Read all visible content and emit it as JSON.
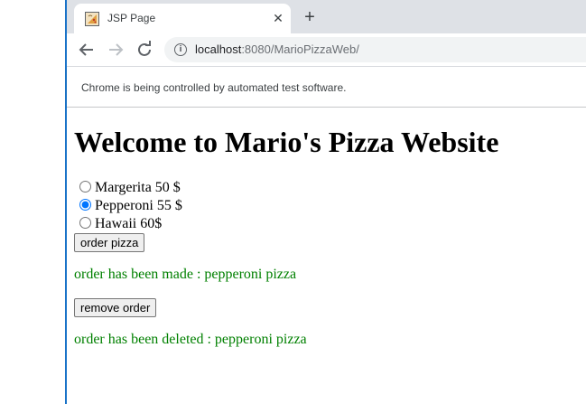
{
  "browser": {
    "tab_title": "JSP Page",
    "url_host": "localhost",
    "url_path": ":8080/MarioPizzaWeb/",
    "infobar_text": "Chrome is being controlled by automated test software."
  },
  "page": {
    "heading": "Welcome to Mario's Pizza Website",
    "pizza_options": [
      {
        "label": "Margerita 50 $",
        "checked": false
      },
      {
        "label": "Pepperoni 55 $",
        "checked": true
      },
      {
        "label": "Hawaii 60$",
        "checked": false
      }
    ],
    "order_button_label": "order pizza",
    "order_message": "order has been made : pepperoni pizza",
    "remove_button_label": "remove order",
    "delete_message": "order has been deleted : pepperoni pizza",
    "message_color": "#008000"
  }
}
